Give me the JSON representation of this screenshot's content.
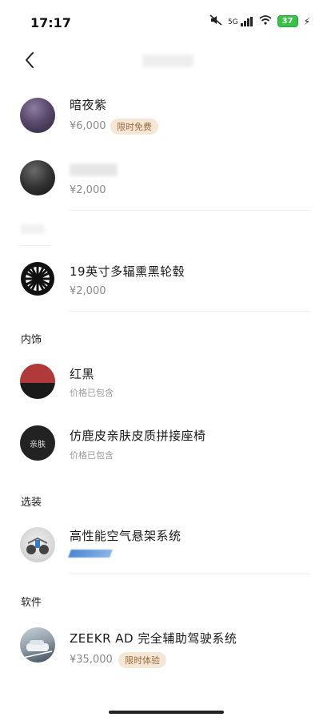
{
  "status": {
    "time": "17:17",
    "network": "5G",
    "battery": "37"
  },
  "items": [
    {
      "title": "暗夜紫",
      "price": "¥6,000",
      "badge": "限时免费"
    },
    {
      "title": "",
      "price": "¥2,000"
    },
    {
      "title": "19英寸多辐熏黑轮毂",
      "price": "¥2,000"
    }
  ],
  "sections": [
    {
      "title": "内饰",
      "items": [
        {
          "title": "红黑",
          "sub": "价格已包含"
        },
        {
          "title": "仿鹿皮亲肤皮质拼接座椅",
          "sub": "价格已包含",
          "thumb_label": "亲肤"
        }
      ]
    },
    {
      "title": "选装",
      "items": [
        {
          "title": "高性能空气悬架系统"
        }
      ]
    },
    {
      "title": "软件",
      "items": [
        {
          "title": "ZEEKR AD 完全辅助驾驶系统",
          "price": "¥35,000",
          "badge": "限时体验"
        }
      ]
    }
  ],
  "colors": {
    "badge_bg": "#f6e6d6",
    "badge_text": "#9a6a3a",
    "purple": "#5a4a6e",
    "red": "#b03a3a"
  }
}
